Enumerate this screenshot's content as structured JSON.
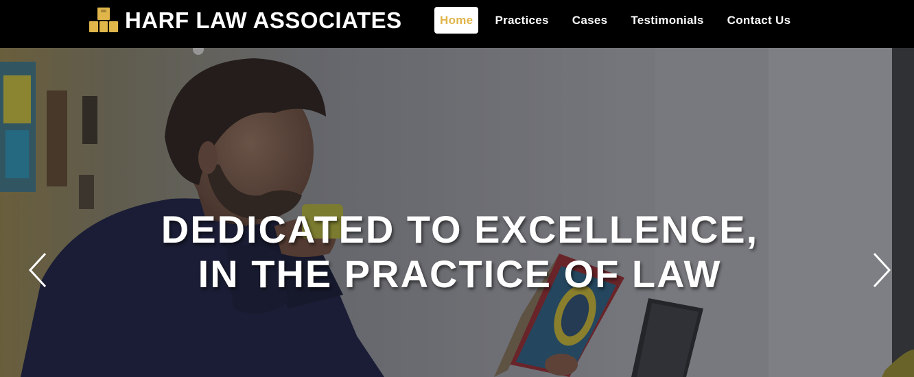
{
  "brand": {
    "name": "HARF LAW ASSOCIATES",
    "logo_icon": "stacked-blocks-icon",
    "logo_color": "#e0b54a"
  },
  "nav": {
    "items": [
      {
        "label": "Home",
        "active": true
      },
      {
        "label": "Practices",
        "active": false
      },
      {
        "label": "Cases",
        "active": false
      },
      {
        "label": "Testimonials",
        "active": false
      },
      {
        "label": "Contact Us",
        "active": false
      }
    ],
    "active_color": "#e0b54a"
  },
  "hero": {
    "caption_line1": "DEDICATED TO EXCELLENCE,",
    "caption_line2": "IN THE PRACTICE OF LAW",
    "prev_icon": "chevron-left-icon",
    "next_icon": "chevron-right-icon"
  }
}
